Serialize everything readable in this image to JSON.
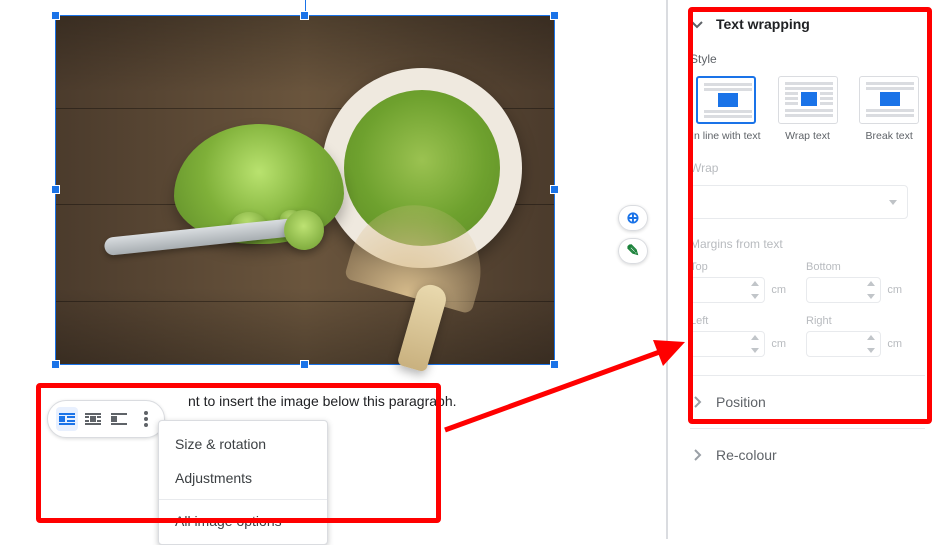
{
  "doc": {
    "paragraph_text": "nt to insert the image below this paragraph."
  },
  "pill_toolbar": {
    "options": [
      {
        "name": "in-line-with-text",
        "selected": true
      },
      {
        "name": "wrap-text",
        "selected": false
      },
      {
        "name": "break-text",
        "selected": false
      }
    ]
  },
  "overflow_menu": {
    "items": {
      "size_rotation": "Size & rotation",
      "adjustments": "Adjustments",
      "all_image_options": "All image options"
    }
  },
  "sidebar": {
    "text_wrapping": {
      "title": "Text wrapping",
      "expanded": true,
      "style_label": "Style",
      "styles": [
        {
          "id": "inline",
          "label": "In line with text",
          "selected": true
        },
        {
          "id": "wrap",
          "label": "Wrap text",
          "selected": false
        },
        {
          "id": "break",
          "label": "Break text",
          "selected": false
        }
      ],
      "wrap_label": "Wrap",
      "wrap_select_enabled": false,
      "margins_label": "Margins from text",
      "margins": {
        "top": {
          "label": "Top",
          "unit": "cm"
        },
        "bottom": {
          "label": "Bottom",
          "unit": "cm"
        },
        "left": {
          "label": "Left",
          "unit": "cm"
        },
        "right": {
          "label": "Right",
          "unit": "cm"
        }
      }
    },
    "position": {
      "title": "Position",
      "expanded": false
    },
    "recolour": {
      "title": "Re-colour",
      "expanded": false
    }
  }
}
